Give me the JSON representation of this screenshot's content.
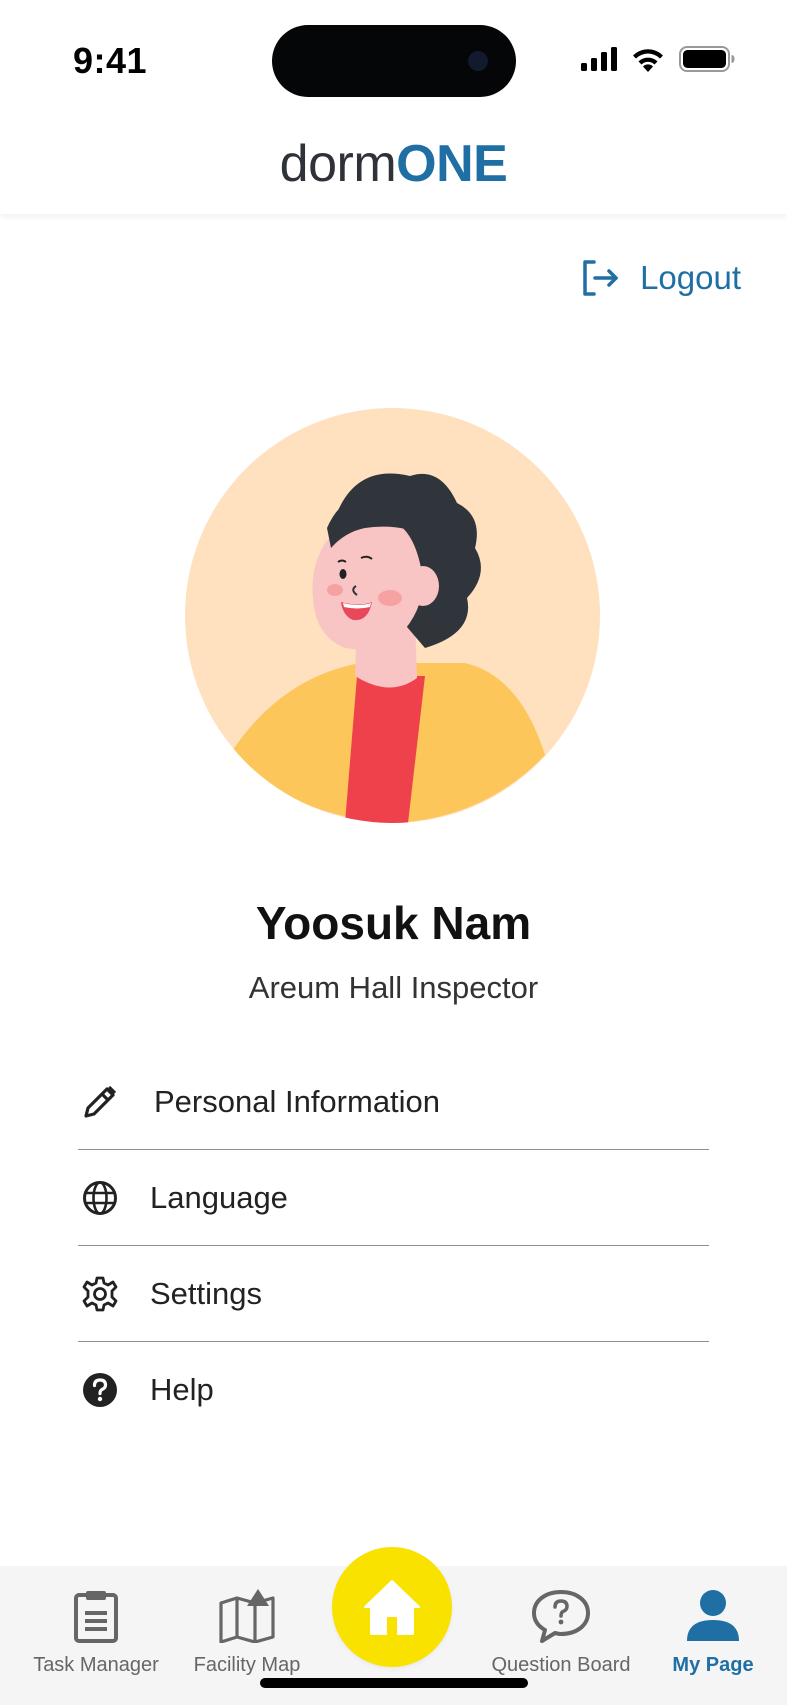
{
  "status_bar": {
    "time": "9:41"
  },
  "header": {
    "brand_part1": "dorm",
    "brand_part2": "ONE"
  },
  "logout": {
    "label": "Logout",
    "icon": "logout-icon"
  },
  "profile": {
    "name": "Yoosuk Nam",
    "role": "Areum Hall Inspector"
  },
  "menu": {
    "items": [
      {
        "label": "Personal Information",
        "icon": "pencil-icon"
      },
      {
        "label": "Language",
        "icon": "globe-icon"
      },
      {
        "label": "Settings",
        "icon": "gear-icon"
      },
      {
        "label": "Help",
        "icon": "help-icon"
      }
    ]
  },
  "tab_bar": {
    "tabs": [
      {
        "label": "Task Manager",
        "icon": "clipboard-icon"
      },
      {
        "label": "Facility Map",
        "icon": "map-icon"
      },
      {
        "label": "Question Board",
        "icon": "question-bubble-icon"
      },
      {
        "label": "My Page",
        "icon": "user-icon",
        "active": true
      }
    ],
    "home_icon": "home-icon"
  },
  "colors": {
    "accent": "#1f6fa5",
    "home_button": "#f9e200",
    "avatar_bg": "#ffe0bf",
    "tab_bar_bg": "#f5f5f5"
  }
}
